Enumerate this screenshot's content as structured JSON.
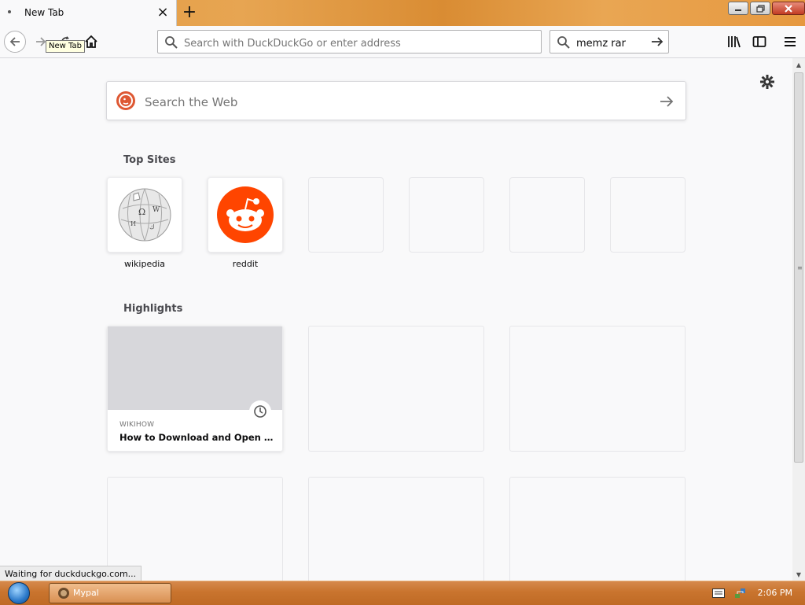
{
  "browser": {
    "tab": {
      "title": "New Tab",
      "close_label": "×"
    },
    "new_tab_button_label": "+",
    "tooltip": "New Tab",
    "urlbar": {
      "placeholder": "Search with DuckDuckGo or enter address",
      "value": ""
    },
    "searchbar": {
      "value": "memz rar"
    }
  },
  "newtab": {
    "web_search": {
      "placeholder": "Search the Web"
    },
    "top_sites_title": "Top Sites",
    "top_sites": [
      {
        "label": "wikipedia",
        "icon": "wikipedia-globe"
      },
      {
        "label": "reddit",
        "icon": "reddit-alien"
      },
      {
        "label": ""
      },
      {
        "label": ""
      },
      {
        "label": ""
      },
      {
        "label": ""
      }
    ],
    "highlights_title": "Highlights",
    "highlights": [
      {
        "source": "WIKIHOW",
        "title": "How to Download and Open Torrent Files"
      }
    ]
  },
  "status_text": "Waiting for duckduckgo.com...",
  "taskbar": {
    "item_label": "Mypal",
    "clock": "2:06 PM"
  },
  "colors": {
    "reddit": "#ff4500",
    "duckduckgo": "#de5833",
    "taskbar": "#c9742e"
  }
}
